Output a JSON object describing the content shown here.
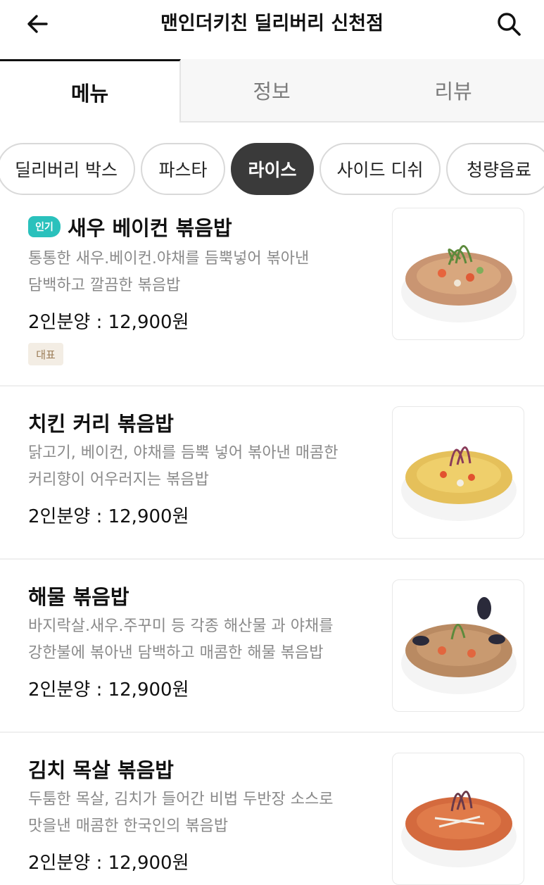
{
  "header": {
    "title": "맨인더키친 딜리버리 신천점",
    "back_icon": "arrow-left-icon",
    "search_icon": "search-icon"
  },
  "tabs": [
    {
      "label": "메뉴",
      "active": true
    },
    {
      "label": "정보",
      "active": false
    },
    {
      "label": "리뷰",
      "active": false
    }
  ],
  "categories": [
    {
      "label": "딜리버리 박스",
      "active": false
    },
    {
      "label": "파스타",
      "active": false
    },
    {
      "label": "라이스",
      "active": true
    },
    {
      "label": "사이드 디쉬",
      "active": false
    },
    {
      "label": "청량음료",
      "active": false
    }
  ],
  "colors": {
    "accent": "#2ac1bc",
    "chip_active": "#3a3a3a",
    "tag_bg": "#f3ede4"
  },
  "menu": [
    {
      "badge": "인기",
      "name": "새우 베이컨 볶음밥",
      "desc_line1": "통통한 새우.베이컨.야채를 듬뿍넣어 볶아낸",
      "desc_line2": "담백하고 깔끔한 볶음밥",
      "price": "2인분양 : 12,900원",
      "tag": "대표"
    },
    {
      "name": "치킨 커리 볶음밥",
      "desc_line1": "닭고기, 베이컨, 야채를 듬뿍 넣어 볶아낸 매콤한",
      "desc_line2": "커리향이 어우러지는 볶음밥",
      "price": "2인분양 : 12,900원"
    },
    {
      "name": "해물 볶음밥",
      "desc_line1": "바지락살.새우.주꾸미 등 각종 해산물 과 야채를",
      "desc_line2": "강한불에 볶아낸 담백하고 매콤한 해물 볶음밥",
      "price": "2인분양 : 12,900원"
    },
    {
      "name": "김치 목살 볶음밥",
      "desc_line1": "두툼한 목살, 김치가 들어간 비법 두반장 소스로",
      "desc_line2": "맛을낸 매콤한 한국인의 볶음밥",
      "price": "2인분양 : 12,900원"
    }
  ]
}
